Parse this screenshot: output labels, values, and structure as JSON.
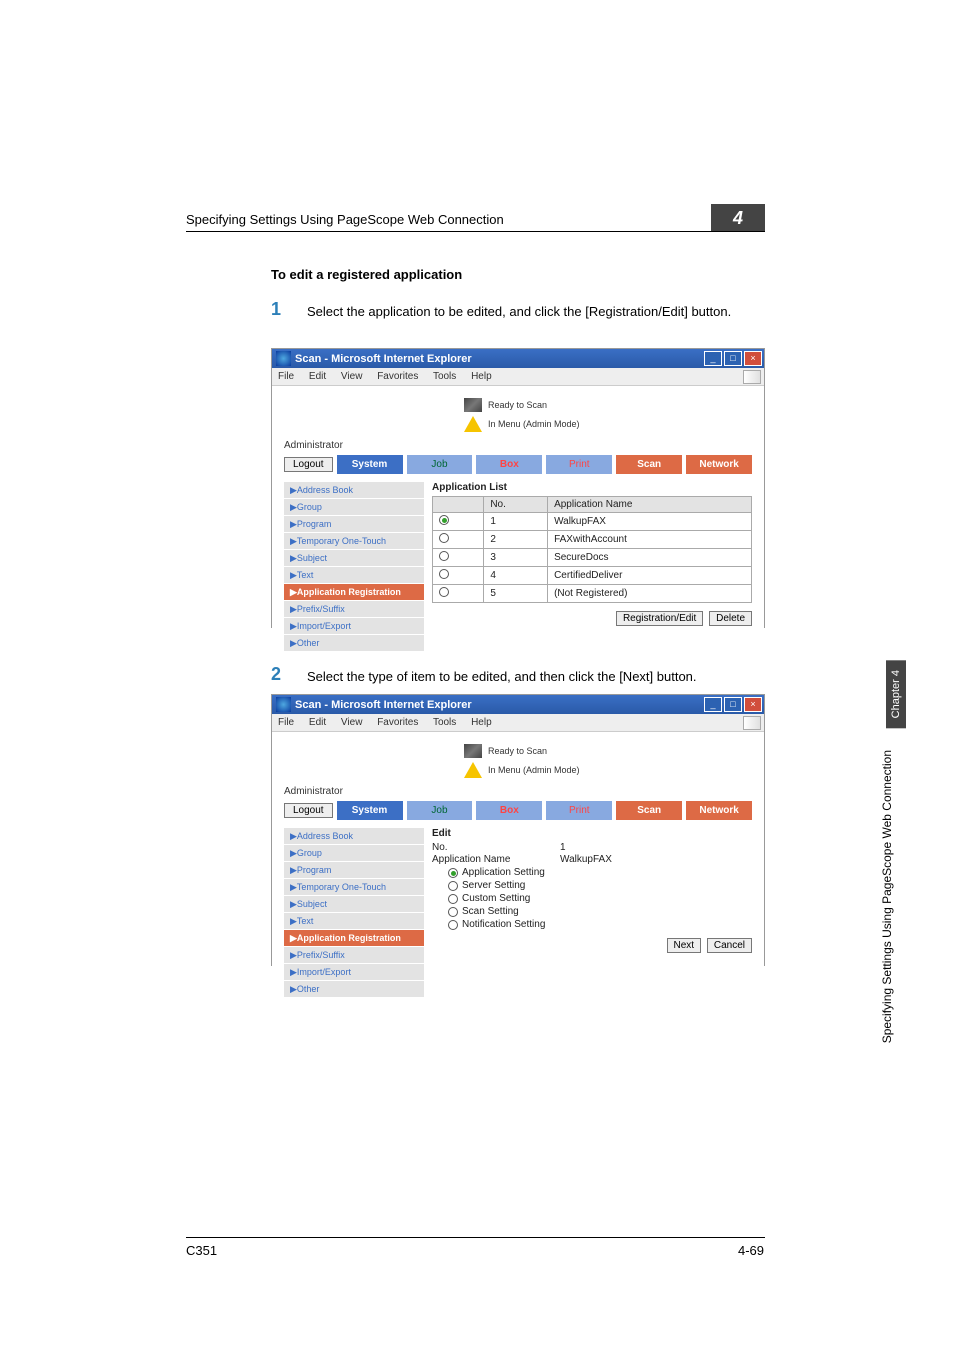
{
  "header": {
    "running": "Specifying Settings Using PageScope Web Connection",
    "chapter_tab": "4"
  },
  "section": {
    "title": "To edit a registered application"
  },
  "steps": [
    {
      "num": "1",
      "text": "Select the application to be edited, and click the [Registration/Edit] button."
    },
    {
      "num": "2",
      "text": "Select the type of item to be edited, and then click the [Next] button."
    }
  ],
  "ie_menu": [
    "File",
    "Edit",
    "View",
    "Favorites",
    "Tools",
    "Help"
  ],
  "status": {
    "ready": "Ready to Scan",
    "mode": "In Menu (Admin Mode)",
    "admin": "Administrator"
  },
  "buttons": {
    "logout": "Logout",
    "reg_edit": "Registration/Edit",
    "delete": "Delete",
    "next": "Next",
    "cancel": "Cancel"
  },
  "tabs": [
    "System",
    "Job",
    "Box",
    "Print",
    "Scan",
    "Network"
  ],
  "sidemenu": [
    "▶Address Book",
    "▶Group",
    "▶Program",
    "▶Temporary One-Touch",
    "▶Subject",
    "▶Text",
    "▶Application Registration",
    "▶Prefix/Suffix",
    "▶Import/Export",
    "▶Other"
  ],
  "shot1": {
    "window_title": "Scan - Microsoft Internet Explorer",
    "heading": "Application List",
    "cols": [
      "No.",
      "Application Name"
    ],
    "rows": [
      {
        "no": "1",
        "name": "WalkupFAX"
      },
      {
        "no": "2",
        "name": "FAXwithAccount"
      },
      {
        "no": "3",
        "name": "SecureDocs"
      },
      {
        "no": "4",
        "name": "CertifiedDeliver"
      },
      {
        "no": "5",
        "name": "(Not Registered)"
      }
    ]
  },
  "shot2": {
    "window_title": "Scan - Microsoft Internet Explorer",
    "heading": "Edit",
    "labels": {
      "no": "No.",
      "app": "Application Name"
    },
    "values": {
      "no": "1",
      "app": "WalkupFAX"
    },
    "opts": [
      "Application Setting",
      "Server Setting",
      "Custom Setting",
      "Scan Setting",
      "Notification Setting"
    ]
  },
  "side": {
    "chapter": "Chapter 4",
    "text": "Specifying Settings Using PageScope Web Connection"
  },
  "footer": {
    "left": "C351",
    "right": "4-69"
  }
}
